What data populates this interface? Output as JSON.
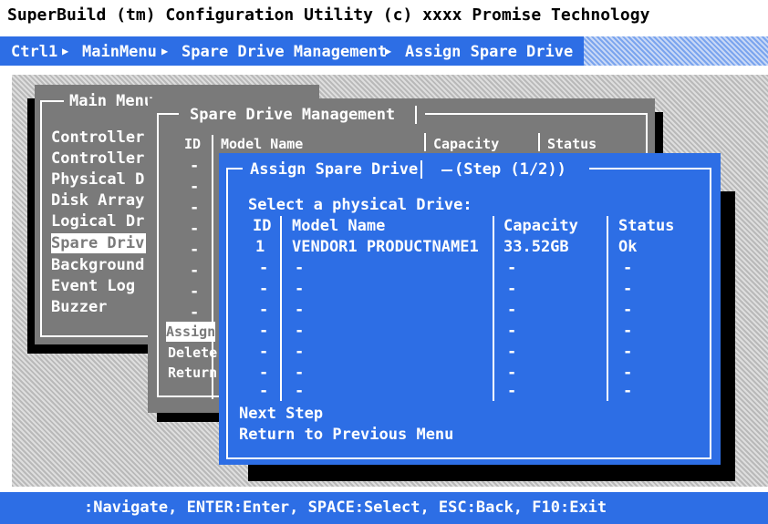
{
  "title": "SuperBuild (tm) Configuration Utility (c) xxxx Promise Technology",
  "breadcrumb": [
    "Ctrl1",
    "MainMenu",
    "Spare Drive Management",
    "Assign Spare Drive"
  ],
  "main_menu": {
    "title": "Main Menu",
    "items": [
      "Controller",
      "Controller",
      "Physical D",
      "Disk Array",
      "Logical Dr",
      "Spare Driv",
      "Background",
      "Event Log",
      "Buzzer"
    ],
    "selected_index": 5
  },
  "spare_mgmt": {
    "title": "Spare Drive Management",
    "headers": [
      "ID",
      "Model Name",
      "Capacity",
      "Status"
    ],
    "id_placeholders": [
      "-",
      "-",
      "-",
      "-",
      "-",
      "-",
      "-",
      "-"
    ],
    "actions": [
      "Assign",
      "Delete",
      "Return"
    ]
  },
  "assign": {
    "title": "Assign Spare Drive",
    "step": "(Step (1/2))",
    "prompt": "Select a physical Drive:",
    "headers": [
      "ID",
      "Model Name",
      "Capacity",
      "Status"
    ],
    "rows": [
      {
        "id": "1",
        "model": "VENDOR1 PRODUCTNAME1",
        "capacity": "33.52GB",
        "status": "Ok"
      },
      {
        "id": "-",
        "model": "-",
        "capacity": "-",
        "status": "-"
      },
      {
        "id": "-",
        "model": "-",
        "capacity": "-",
        "status": "-"
      },
      {
        "id": "-",
        "model": "-",
        "capacity": "-",
        "status": "-"
      },
      {
        "id": "-",
        "model": "-",
        "capacity": "-",
        "status": "-"
      },
      {
        "id": "-",
        "model": "-",
        "capacity": "-",
        "status": "-"
      },
      {
        "id": "-",
        "model": "-",
        "capacity": "-",
        "status": "-"
      },
      {
        "id": "-",
        "model": "-",
        "capacity": "-",
        "status": "-"
      }
    ],
    "actions": [
      "Next Step",
      "Return to Previous Menu"
    ]
  },
  "help": ":Navigate, ENTER:Enter, SPACE:Select, ESC:Back, F10:Exit",
  "colors": {
    "blue": "#2d6ee5",
    "gray": "#7a7a7a",
    "white": "#ffffff",
    "black": "#000000"
  }
}
